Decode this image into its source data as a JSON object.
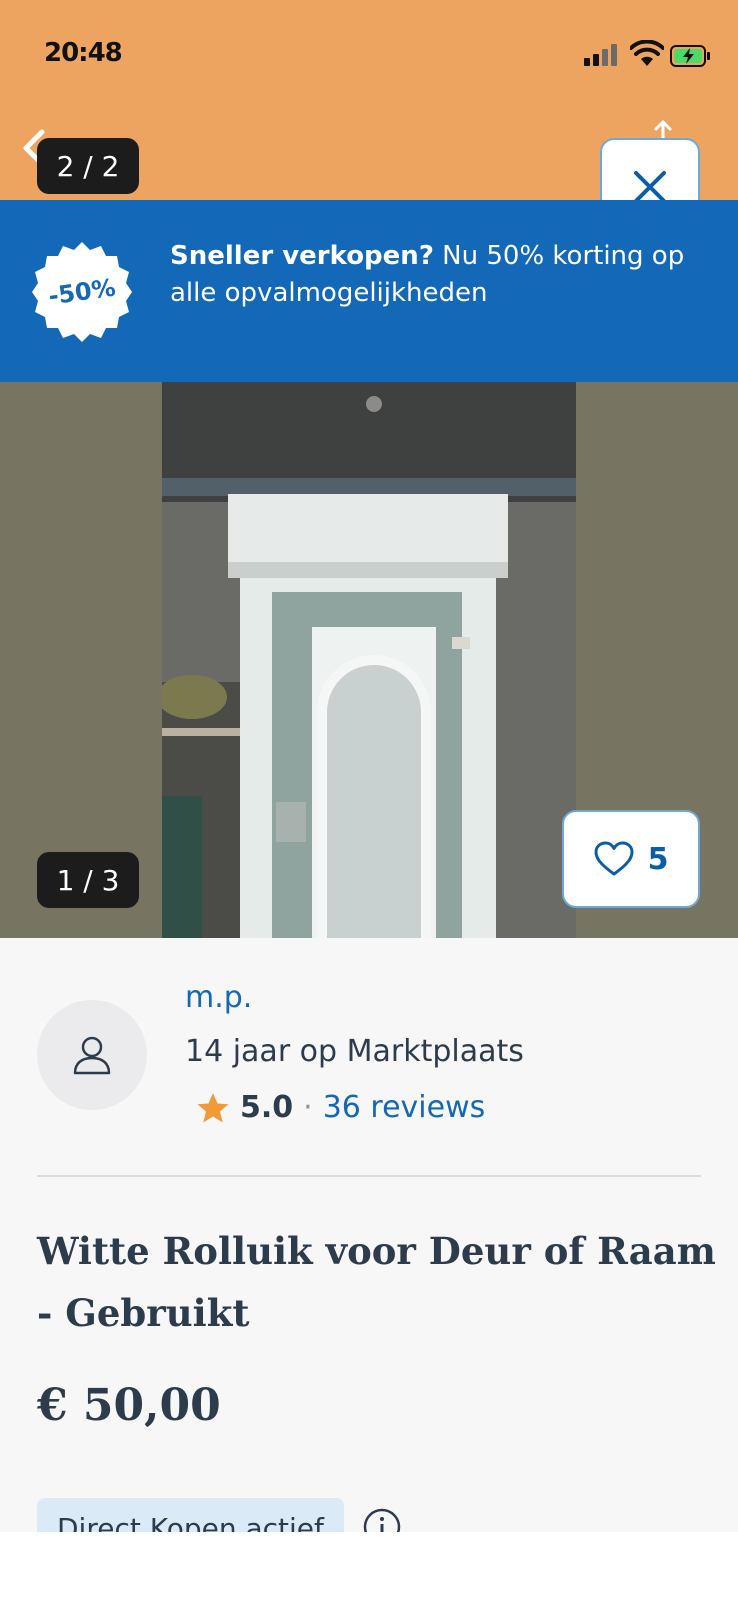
{
  "status_bar": {
    "time": "20:48"
  },
  "gallery": {
    "top_counter": "2 / 2",
    "bottom_counter": "1 / 3",
    "favorites_count": "5"
  },
  "promo": {
    "badge": "-50%",
    "text_bold": "Sneller verkopen?",
    "text_rest": " Nu 50% korting op alle opvalmogelijkheden"
  },
  "seller": {
    "name": "m.p.",
    "years": "14 jaar op Marktplaats",
    "rating": "5.0",
    "separator": "·",
    "reviews": "36 reviews"
  },
  "listing": {
    "title": "Witte Rolluik voor Deur of Raam - Gebruikt",
    "price": "€ 50,00",
    "direct_buy": "Direct Kopen actief"
  },
  "colors": {
    "orange_header": "#eea461",
    "promo_blue": "#1468b8",
    "link_blue": "#1468b8",
    "text_dark": "#2d3c4d",
    "star": "#f29a38"
  }
}
